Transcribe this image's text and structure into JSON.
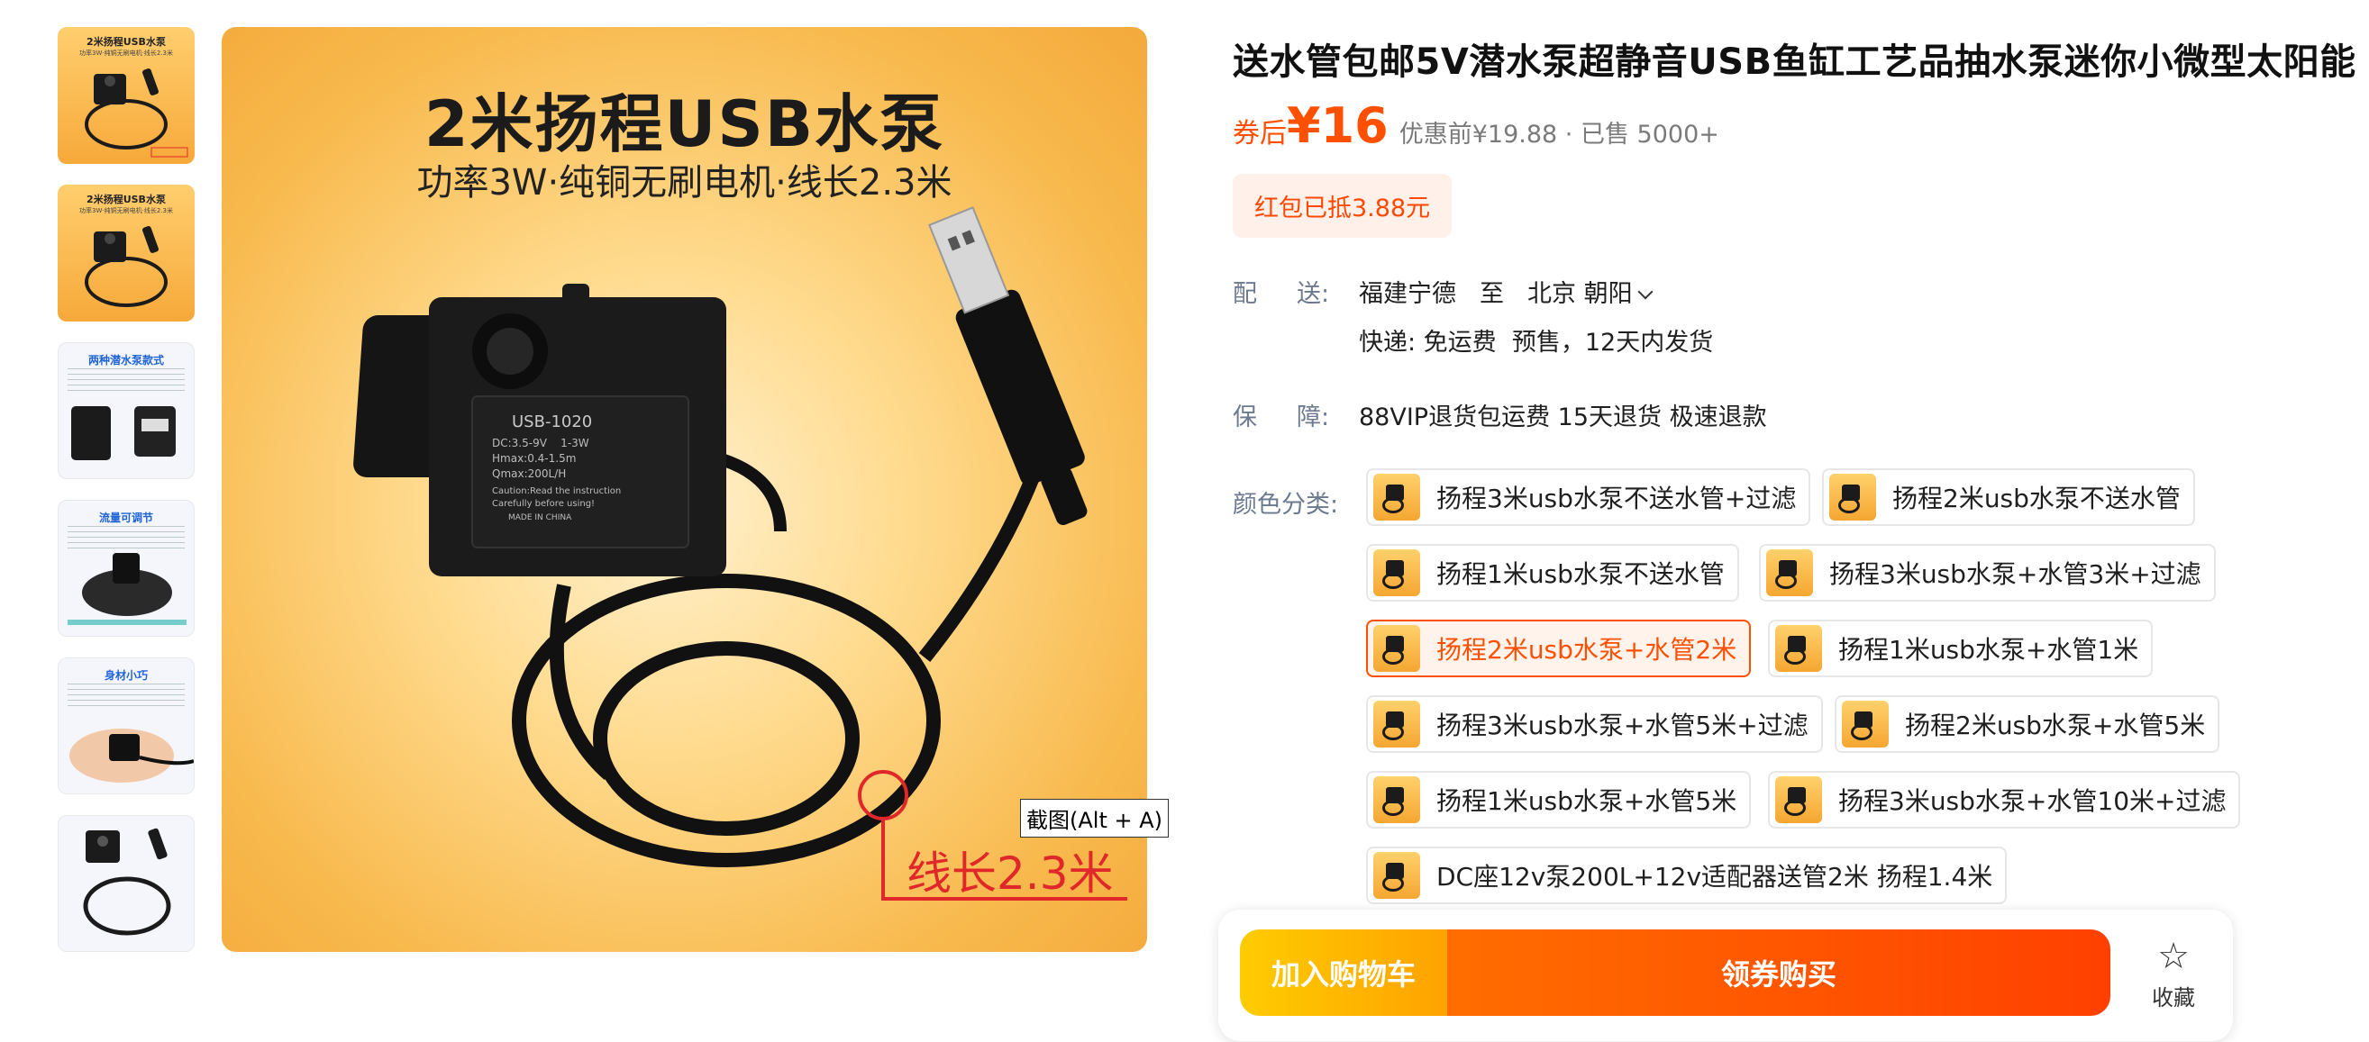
{
  "thumbnails": [
    {
      "title": "2米扬程USB水泵",
      "subtitle": "功率3W·纯铜无刷电机·线长2.3米",
      "style": "orange"
    },
    {
      "title": "2米扬程USB水泵",
      "subtitle": "功率3W·纯铜无刷电机·线长2.3米",
      "style": "orange"
    },
    {
      "title": "两种潜水泵款式",
      "subtitle": "",
      "style": "white"
    },
    {
      "title": "流量可调节",
      "subtitle": "",
      "style": "white"
    },
    {
      "title": "身材小巧",
      "subtitle": "",
      "style": "white"
    },
    {
      "title": "",
      "subtitle": "",
      "style": "white"
    }
  ],
  "main_image": {
    "title": "2米扬程USB水泵",
    "subtitle": "功率3W·纯铜无刷电机·线长2.3米",
    "pump_label": "USB-1020",
    "pump_specs": [
      "DC:3.5-9V    1-3W",
      "Hmax:0.4-1.5m",
      "Qmax:200L/H",
      "Caution:Read the instruction",
      "Carefully before using!",
      "MADE IN CHINA"
    ],
    "caption": "线长2.3米",
    "accent_color": "#e0272a"
  },
  "screenshot_tip": "截图(Alt + A)",
  "product": {
    "title": "送水管包邮5V潜水泵超静音USB鱼缸工艺品抽水泵迷你小微型太阳能",
    "coupon_prefix": "券后",
    "price": "¥16",
    "original_price": "优惠前¥19.88 · 已售 5000+",
    "red_packet": "红包已抵3.88元",
    "brand_color": "#ff5000"
  },
  "shipping": {
    "label_a": "配",
    "label_b": "送:",
    "from": "福建宁德",
    "to_word": "至",
    "to": "北京 朝阳",
    "express": "快递: 免运费",
    "presale": "预售，12天内发货"
  },
  "guarantee": {
    "label_a": "保",
    "label_b": "障:",
    "value": "88VIP退货包运费 15天退货 极速退款"
  },
  "options": {
    "label": "颜色分类:",
    "items": [
      {
        "label": "扬程3米usb水泵不送水管+过滤",
        "selected": false
      },
      {
        "label": "扬程2米usb水泵不送水管",
        "selected": false
      },
      {
        "label": "扬程1米usb水泵不送水管",
        "selected": false
      },
      {
        "label": "扬程3米usb水泵+水管3米+过滤",
        "selected": false
      },
      {
        "label": "扬程2米usb水泵+水管2米",
        "selected": true
      },
      {
        "label": "扬程1米usb水泵+水管1米",
        "selected": false
      },
      {
        "label": "扬程3米usb水泵+水管5米+过滤",
        "selected": false
      },
      {
        "label": "扬程2米usb水泵+水管5米",
        "selected": false
      },
      {
        "label": "扬程1米usb水泵+水管5米",
        "selected": false
      },
      {
        "label": "扬程3米usb水泵+水管10米+过滤",
        "selected": false
      },
      {
        "label": "DC座12v泵200L+12v适配器送管2米 扬程1.4米",
        "selected": false
      }
    ]
  },
  "actions": {
    "add_to_cart": "加入购物车",
    "buy_now": "领券购买",
    "favorite": "收藏",
    "favorite_icon": "star-icon"
  }
}
